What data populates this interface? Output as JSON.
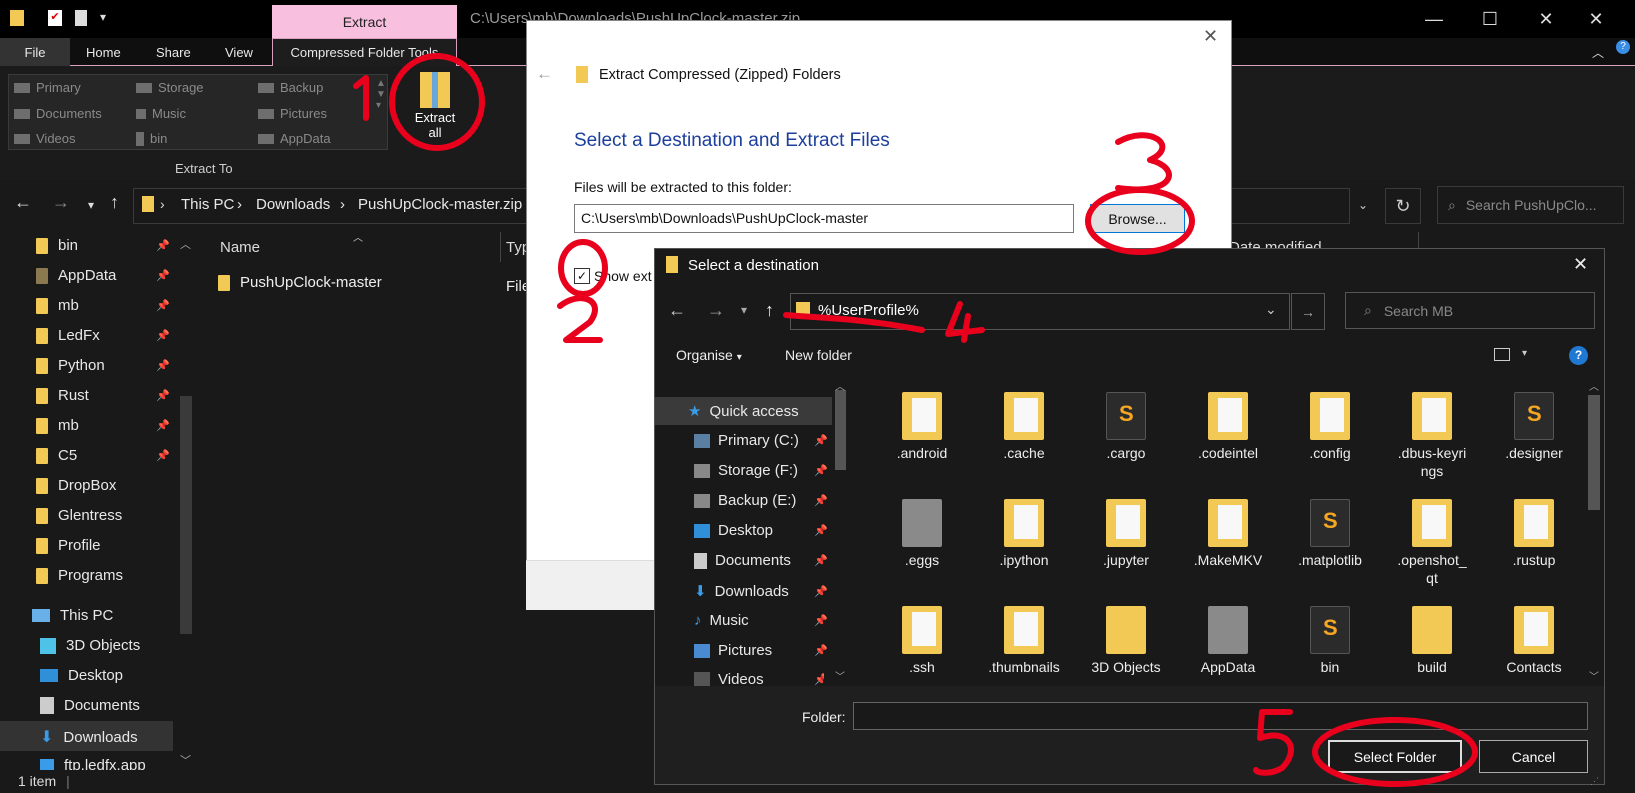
{
  "explorer": {
    "path_title": "C:\\Users\\mb\\Downloads\\PushUpClock-master.zip",
    "extract_tab": "Extract",
    "menu": {
      "file": "File",
      "home": "Home",
      "share": "Share",
      "view": "View",
      "cft": "Compressed Folder Tools"
    },
    "ribbon": {
      "items": [
        "Primary",
        "Storage",
        "Backup",
        "Documents",
        "Music",
        "Pictures",
        "Videos",
        "bin",
        "AppData"
      ],
      "extract_to": "Extract To",
      "extract_all_1": "Extract",
      "extract_all_2": "all"
    },
    "breadcrumb": [
      "This PC",
      "Downloads",
      "PushUpClock-master.zip"
    ],
    "search_placeholder": "Search PushUpClo...",
    "nav": [
      "bin",
      "AppData",
      "mb",
      "LedFx",
      "Python",
      "Rust",
      "mb",
      "C5",
      "DropBox",
      "Glentress",
      "Profile",
      "Programs",
      "This PC",
      "3D Objects",
      "Desktop",
      "Documents",
      "Downloads",
      "ftp.ledfx.app"
    ],
    "columns": {
      "name": "Name",
      "type": "Typ",
      "date": "Date modified"
    },
    "file": {
      "name": "PushUpClock-master",
      "type": "File"
    },
    "status": "1 item"
  },
  "wizard": {
    "title": "Extract Compressed (Zipped) Folders",
    "heading": "Select a Destination and Extract Files",
    "path_label": "Files will be extracted to this folder:",
    "path_value": "C:\\Users\\mb\\Downloads\\PushUpClock-master",
    "browse": "Browse...",
    "checkbox_label": "Show ext"
  },
  "dialog": {
    "title": "Select a destination",
    "address": "%UserProfile%",
    "search_placeholder": "Search MB",
    "organise": "Organise",
    "new_folder": "New folder",
    "nav": [
      "Quick access",
      "Primary (C:)",
      "Storage (F:)",
      "Backup (E:)",
      "Desktop",
      "Documents",
      "Downloads",
      "Music",
      "Pictures",
      "Videos"
    ],
    "tiles": [
      ".android",
      ".cache",
      ".cargo",
      ".codeintel",
      ".config",
      ".dbus-keyrings",
      ".designer",
      ".eggs",
      ".ipython",
      ".jupyter",
      ".MakeMKV",
      ".matplotlib",
      ".openshot_qt",
      ".rustup",
      ".ssh",
      ".thumbnails",
      "3D Objects",
      "AppData",
      "bin",
      "build",
      "Contacts"
    ],
    "tiles_display": [
      ".android",
      ".cache",
      ".cargo",
      ".codeintel",
      ".config",
      ".dbus-keyri\nngs",
      ".designer",
      ".eggs",
      ".ipython",
      ".jupyter",
      ".MakeMKV",
      ".matplotlib",
      ".openshot_\nqt",
      ".rustup",
      ".ssh",
      ".thumbnails",
      "3D Objects",
      "AppData",
      "bin",
      "build",
      "Contacts"
    ],
    "folder_label": "Folder:",
    "select_folder": "Select Folder",
    "cancel": "Cancel"
  },
  "annotations": [
    "1",
    "2",
    "3",
    "4",
    "5"
  ],
  "colors": {
    "annotation": "#e8001c",
    "link_blue": "#1c3f9c",
    "extract_tab": "#f8bfde"
  }
}
